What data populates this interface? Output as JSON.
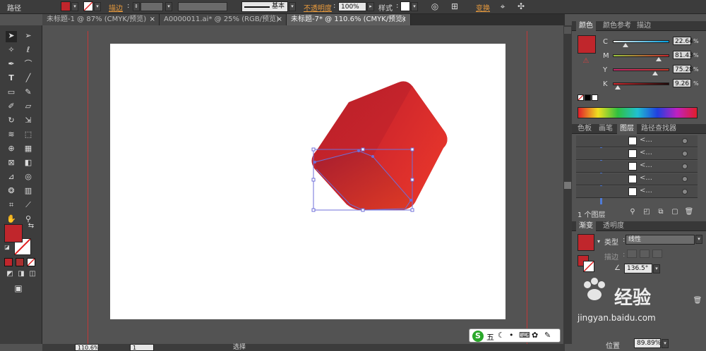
{
  "control_bar": {
    "mode_label": "路径",
    "stroke_label": "描边",
    "stroke_style": "基本",
    "opacity_label": "不透明度",
    "opacity_value": "100%",
    "style_label": "样式",
    "transform_label": "变换"
  },
  "doc_tabs": [
    {
      "label": "未标题-1 @ 87% (CMYK/预览)",
      "close": "×"
    },
    {
      "label": "A0000011.ai* @ 25% (RGB/预览)",
      "close": "×"
    },
    {
      "label": "未标题-7* @ 110.6% (CMYK/预览)",
      "close": "×"
    }
  ],
  "status_bar": {
    "zoom": "110.6%",
    "page": "1",
    "tool": "选择"
  },
  "color_panel": {
    "tabs": [
      "颜色",
      "颜色参考",
      "描边"
    ],
    "fill_color": "#c0262c",
    "sliders": [
      {
        "label": "C",
        "value": "22.64",
        "unit": "%",
        "level": 0.2264
      },
      {
        "label": "M",
        "value": "81.43",
        "unit": "%",
        "level": 0.8143
      },
      {
        "label": "Y",
        "value": "75.28",
        "unit": "%",
        "level": 0.7528
      },
      {
        "label": "K",
        "value": "9.26",
        "unit": "%",
        "level": 0.0926
      }
    ]
  },
  "layers_panel": {
    "tabs": [
      "色板",
      "画笔",
      "图层",
      "路径查找器"
    ],
    "rows": [
      "<...",
      "<...",
      "<...",
      "<...",
      "<..."
    ],
    "footer": "1 个图层"
  },
  "gradient_panel": {
    "tabs": [
      "渐变",
      "透明度"
    ],
    "type_label": "类型",
    "type_value": "线性",
    "stroke_label": "描边",
    "angle_value": "136.5°",
    "location_label": "位置",
    "location_value": "89.89%"
  },
  "ime": {
    "logo": "S",
    "mode": "五"
  },
  "watermark": {
    "brand": "经验",
    "url": "jingyan.baidu.com"
  },
  "colors": {
    "shape_dark": "#b91f2a",
    "shape_light": "#e8322a",
    "selection": "#6f6fd8"
  }
}
